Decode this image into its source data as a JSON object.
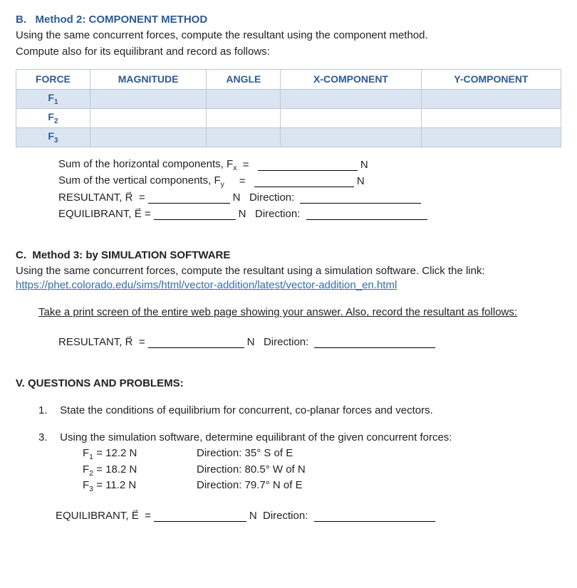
{
  "sectionB": {
    "prefix": "B.",
    "title": "Method 2: COMPONENT METHOD",
    "intro1": "Using the same concurrent forces, compute the resultant using the component method.",
    "intro2": "Compute also for its equilibrant and record as follows:",
    "table": {
      "headers": [
        "FORCE",
        "MAGNITUDE",
        "ANGLE",
        "X-COMPONENT",
        "Y-COMPONENT"
      ],
      "rows": [
        "F1",
        "F2",
        "F3"
      ]
    },
    "calc": {
      "sumH_label": "Sum of the horizontal components, F",
      "sumH_sub": "x",
      "sumV_label": "Sum of the vertical components, F",
      "sumV_sub": "y",
      "eq": "=",
      "unitN": "N",
      "resultant_label": "RESULTANT, ",
      "R": "R",
      "equilibrant_label": "EQUILIBRANT, ",
      "E": "E",
      "direction_label": "Direction:"
    }
  },
  "sectionC": {
    "prefix": "C.",
    "title": "Method 3: by SIMULATION SOFTWARE",
    "intro": "Using the same concurrent forces, compute the resultant using a simulation software. Click the link: ",
    "link": "https://phet.colorado.edu/sims/html/vector-addition/latest/vector-addition_en.html",
    "instruction": "Take a print screen of the entire web page showing your answer. Also, record the resultant as follows:",
    "resultant_label": "RESULTANT, ",
    "R": "R",
    "eq": "=",
    "unitN": "N",
    "direction_label": "Direction:"
  },
  "sectionV": {
    "title": "V. QUESTIONS AND PROBLEMS:",
    "q1_num": "1.",
    "q1_text": "State the conditions of equilibrium for concurrent, co-planar forces and vectors.",
    "q3_num": "3.",
    "q3_text": "Using the simulation software, determine equilibrant of the given concurrent forces:",
    "forces": [
      {
        "name": "F1",
        "mag": "= 12.2 N",
        "dir_label": "Direction:",
        "dir": "35° S of E"
      },
      {
        "name": "F2",
        "mag": "= 18.2 N",
        "dir_label": "Direction:",
        "dir": "80.5° W of N"
      },
      {
        "name": "F3",
        "mag": "= 11.2 N",
        "dir_label": "Direction:",
        "dir": "79.7° N of E"
      }
    ],
    "equilibrant_label": "EQUILIBRANT, ",
    "E": "E",
    "eq": "=",
    "unitN": "N",
    "direction_label": "Direction:"
  }
}
